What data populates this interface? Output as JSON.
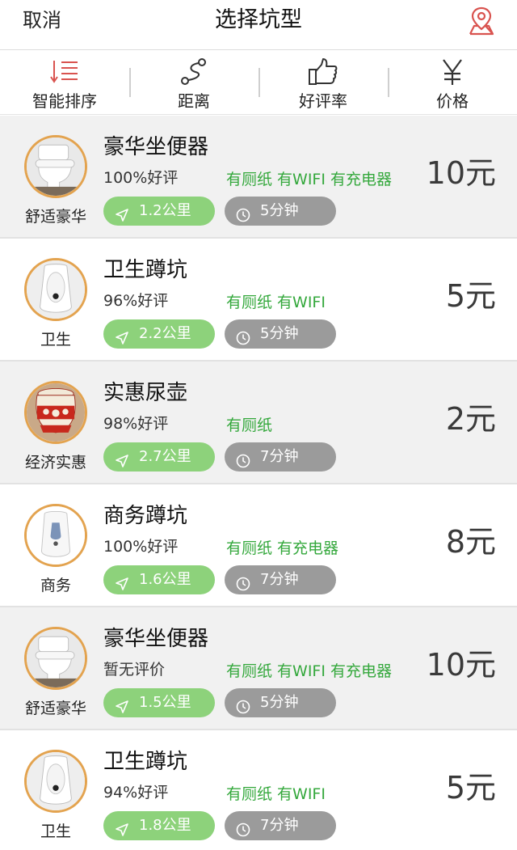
{
  "header": {
    "cancel_label": "取消",
    "title": "选择坑型",
    "map_icon": "map-pin-icon"
  },
  "sort_tabs": [
    {
      "label": "智能排序",
      "icon": "sort-list-icon"
    },
    {
      "label": "距离",
      "icon": "route-icon"
    },
    {
      "label": "好评率",
      "icon": "thumbs-up-icon"
    },
    {
      "label": "价格",
      "icon": "yen-icon"
    }
  ],
  "colors": {
    "amenity_green": "#34a83c",
    "distance_pill": "#8dd27b",
    "time_pill": "#9b9b9b",
    "avatar_ring": "#e3a34f",
    "accent_red": "#d9534f"
  },
  "items": [
    {
      "category": "舒适豪华",
      "name": "豪华坐便器",
      "rating": "100%好评",
      "amenities": "有厕纸 有WIFI 有充电器",
      "distance": "1.2公里",
      "time": "5分钟",
      "price": "10元",
      "image": "western-toilet"
    },
    {
      "category": "卫生",
      "name": "卫生蹲坑",
      "rating": "96%好评",
      "amenities": "有厕纸 有WIFI",
      "distance": "2.2公里",
      "time": "5分钟",
      "price": "5元",
      "image": "squat-toilet"
    },
    {
      "category": "经济实惠",
      "name": "实惠尿壶",
      "rating": "98%好评",
      "amenities": "有厕纸",
      "distance": "2.7公里",
      "time": "7分钟",
      "price": "2元",
      "image": "chamber-pot"
    },
    {
      "category": "商务",
      "name": "商务蹲坑",
      "rating": "100%好评",
      "amenities": "有厕纸 有充电器",
      "distance": "1.6公里",
      "time": "7分钟",
      "price": "8元",
      "image": "squat-toilet-blue"
    },
    {
      "category": "舒适豪华",
      "name": "豪华坐便器",
      "rating": "暂无评价",
      "amenities": "有厕纸 有WIFI 有充电器",
      "distance": "1.5公里",
      "time": "5分钟",
      "price": "10元",
      "image": "western-toilet"
    },
    {
      "category": "卫生",
      "name": "卫生蹲坑",
      "rating": "94%好评",
      "amenities": "有厕纸 有WIFI",
      "distance": "1.8公里",
      "time": "7分钟",
      "price": "5元",
      "image": "squat-toilet"
    }
  ]
}
